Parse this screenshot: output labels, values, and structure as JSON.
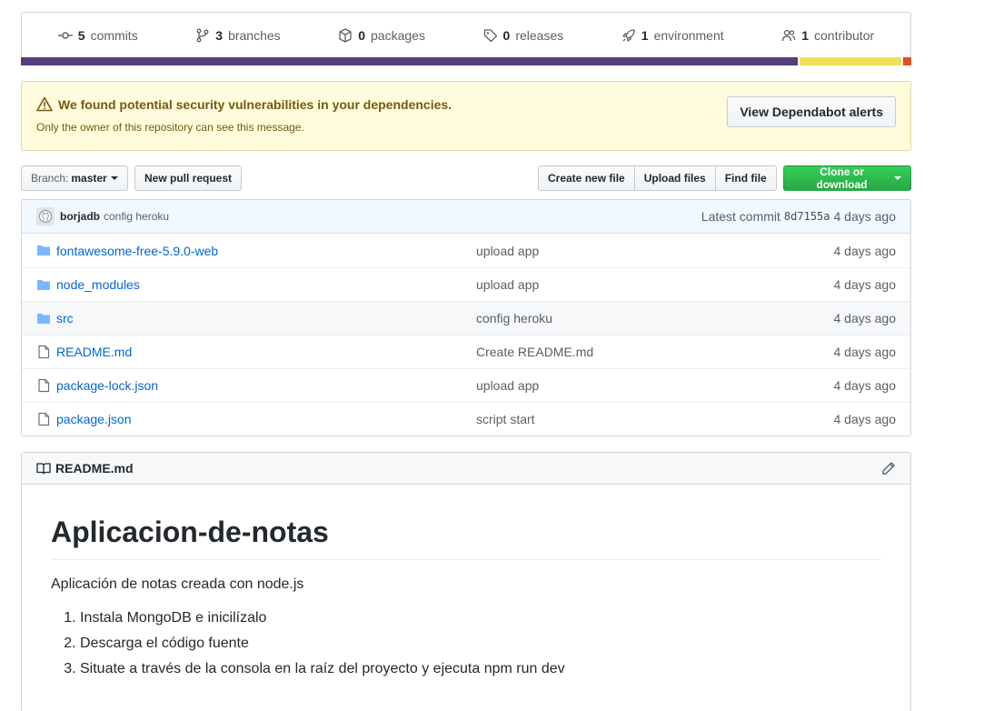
{
  "summary": {
    "commits": {
      "num": "5",
      "label": "commits"
    },
    "branches": {
      "num": "3",
      "label": "branches"
    },
    "packages": {
      "num": "0",
      "label": "packages"
    },
    "releases": {
      "num": "0",
      "label": "releases"
    },
    "environment": {
      "num": "1",
      "label": "environment"
    },
    "contributors": {
      "num": "1",
      "label": "contributor"
    }
  },
  "language_bar": [
    {
      "color": "#563d7c",
      "percent": 87.2
    },
    {
      "color": "#f1e05a",
      "percent": 11.7
    },
    {
      "color": "#e34c26",
      "percent": 1.1
    }
  ],
  "flash": {
    "title": "We found potential security vulnerabilities in your dependencies.",
    "subtitle": "Only the owner of this repository can see this message.",
    "button": "View Dependabot alerts"
  },
  "filenav": {
    "branch_label": "Branch:",
    "branch_name": "master",
    "new_pr": "New pull request",
    "create_file": "Create new file",
    "upload_files": "Upload files",
    "find_file": "Find file",
    "clone": "Clone or download"
  },
  "commit": {
    "author": "borjadb",
    "message": "config heroku",
    "latest_label": "Latest commit",
    "sha": "8d7155a",
    "age": "4 days ago"
  },
  "files": [
    {
      "type": "folder",
      "name": "fontawesome-free-5.9.0-web",
      "message": "upload app",
      "age": "4 days ago"
    },
    {
      "type": "folder",
      "name": "node_modules",
      "message": "upload app",
      "age": "4 days ago"
    },
    {
      "type": "folder",
      "name": "src",
      "message": "config heroku",
      "age": "4 days ago"
    },
    {
      "type": "file",
      "name": "README.md",
      "message": "Create README.md",
      "age": "4 days ago"
    },
    {
      "type": "file",
      "name": "package-lock.json",
      "message": "upload app",
      "age": "4 days ago"
    },
    {
      "type": "file",
      "name": "package.json",
      "message": "script start",
      "age": "4 days ago"
    }
  ],
  "readme": {
    "filename": "README.md",
    "heading": "Aplicacion-de-notas",
    "paragraph": "Aplicación de notas creada con node.js",
    "steps": [
      "Instala MongoDB e inicilízalo",
      "Descarga el código fuente",
      "Situate a través de la consola en la raíz del proyecto y ejecuta npm run dev"
    ]
  },
  "colors": {
    "link": "#0366d6",
    "flash_bg": "#fffbdd",
    "flash_text": "#735c0f",
    "commit_bg": "#f1f8ff",
    "folder_icon": "#79b8ff",
    "green_button": "#28a745"
  }
}
